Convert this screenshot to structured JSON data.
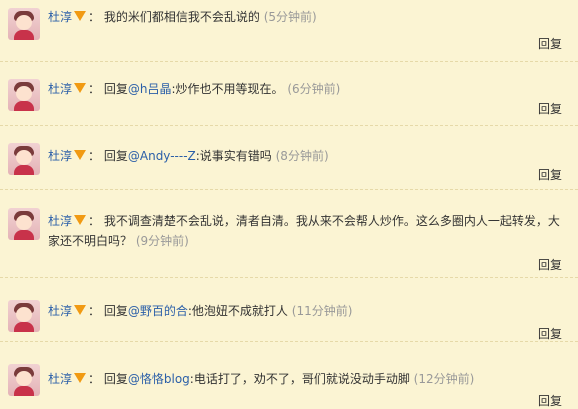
{
  "comments": [
    {
      "name": "杜淳",
      "colon": "：",
      "prefix": "",
      "at": "",
      "text": "我的米们都相信我不会乱说的",
      "time": "(5分钟前)",
      "reply": "回复"
    },
    {
      "name": "杜淳",
      "colon": "：",
      "prefix": "回复",
      "at": "@h吕晶",
      "text": ":炒作也不用等现在。",
      "time": "(6分钟前)",
      "reply": "回复"
    },
    {
      "name": "杜淳",
      "colon": "：",
      "prefix": "回复",
      "at": "@Andy----Z",
      "text": ":说事实有错吗",
      "time": "(8分钟前)",
      "reply": "回复"
    },
    {
      "name": "杜淳",
      "colon": "：",
      "prefix": "",
      "at": "",
      "text": "我不调查清楚不会乱说，清者自清。我从来不会帮人炒作。这么多圈内人一起转发，大家还不明白吗？",
      "time": "(9分钟前)",
      "reply": "回复"
    },
    {
      "name": "杜淳",
      "colon": "：",
      "prefix": "回复",
      "at": "@野百的合",
      "text": ":他泡妞不成就打人",
      "time": "(11分钟前)",
      "reply": "回复"
    },
    {
      "name": "杜淳",
      "colon": "：",
      "prefix": "回复",
      "at": "@恪恪blog",
      "text": ":电话打了，劝不了，哥们就说没动手动脚",
      "time": "(12分钟前)",
      "reply": "回复"
    }
  ]
}
